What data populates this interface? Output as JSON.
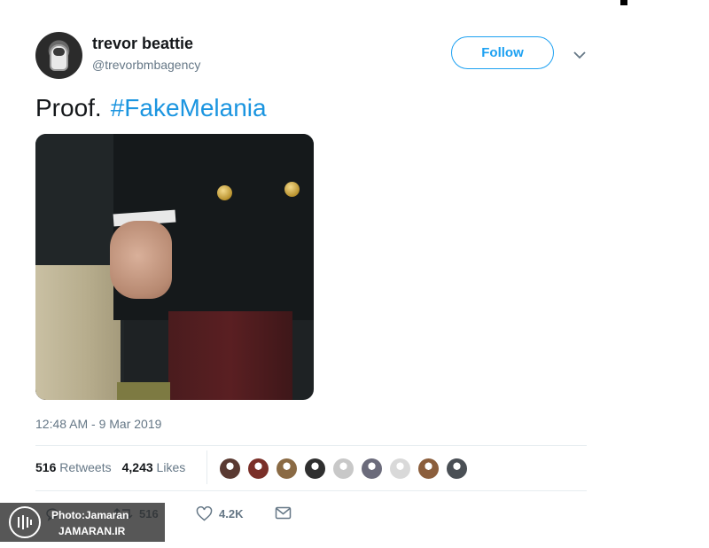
{
  "user": {
    "display_name": "trevor beattie",
    "handle": "@trevorbmbagency",
    "avatar_icon": "astronaut-avatar"
  },
  "follow_button": {
    "label": "Follow"
  },
  "menu": {
    "icon": "chevron-down-icon"
  },
  "tweet": {
    "text": "Proof.",
    "hashtag": "#FakeMelania",
    "timestamp": "12:48 AM - 9 Mar 2019"
  },
  "stats": {
    "retweets_count": "516",
    "retweets_label": "Retweets",
    "likes_count": "4,243",
    "likes_label": "Likes"
  },
  "actions": {
    "reply_icon": "reply-icon",
    "retweet_icon": "retweet-icon",
    "retweet_count": "516",
    "like_icon": "heart-icon",
    "like_count": "4.2K",
    "dm_icon": "envelope-icon"
  },
  "watermark": {
    "line1": "Photo:Jamaran",
    "line2": "JAMARAN.IR"
  },
  "colors": {
    "accent": "#1da1f2",
    "hashtag": "#1b95e0",
    "muted": "#657786",
    "liker_avatars": [
      "#5a3a32",
      "#7a2f28",
      "#8a6a44",
      "#2f2f2f",
      "#c8c8c8",
      "#6b6b7b",
      "#d9d9d9",
      "#8b5e3c",
      "#4a4f55"
    ]
  }
}
